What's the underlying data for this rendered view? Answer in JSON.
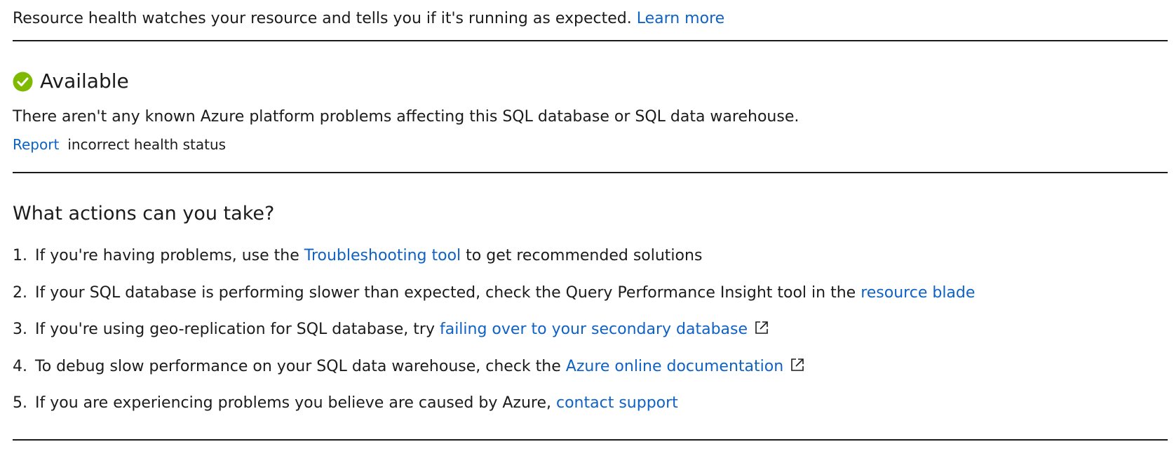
{
  "intro": {
    "text": "Resource health watches your resource and tells you if it's running as expected.",
    "link": "Learn more"
  },
  "status": {
    "icon": "check-circle-icon",
    "icon_color": "#7fba00",
    "title": "Available",
    "description": "There aren't any known Azure platform problems affecting this SQL database or SQL data warehouse.",
    "report_link": "Report",
    "report_text": "incorrect health status"
  },
  "actions": {
    "heading": "What actions can you take?",
    "items": [
      {
        "number": "1.",
        "before": "If you're having problems, use the",
        "link": "Troubleshooting tool",
        "after": "to get recommended solutions"
      },
      {
        "number": "2.",
        "before": "If your SQL database is performing slower than expected, check the Query Performance Insight tool in the",
        "link": "resource blade"
      },
      {
        "number": "3.",
        "before": "If you're using geo-replication for SQL database, try",
        "link": "failing over to your secondary database",
        "icon": "external-link-icon"
      },
      {
        "number": "4.",
        "before": "To debug slow performance on your SQL data warehouse, check the",
        "link": "Azure online documentation",
        "icon": "external-link-icon"
      },
      {
        "number": "5.",
        "before": "If you are experiencing problems you believe are caused by Azure,",
        "link": "contact support"
      }
    ]
  },
  "colors": {
    "link": "#0f62c5",
    "text": "#1b1b1b",
    "divider": "#1b1b1b",
    "available": "#7fba00"
  }
}
